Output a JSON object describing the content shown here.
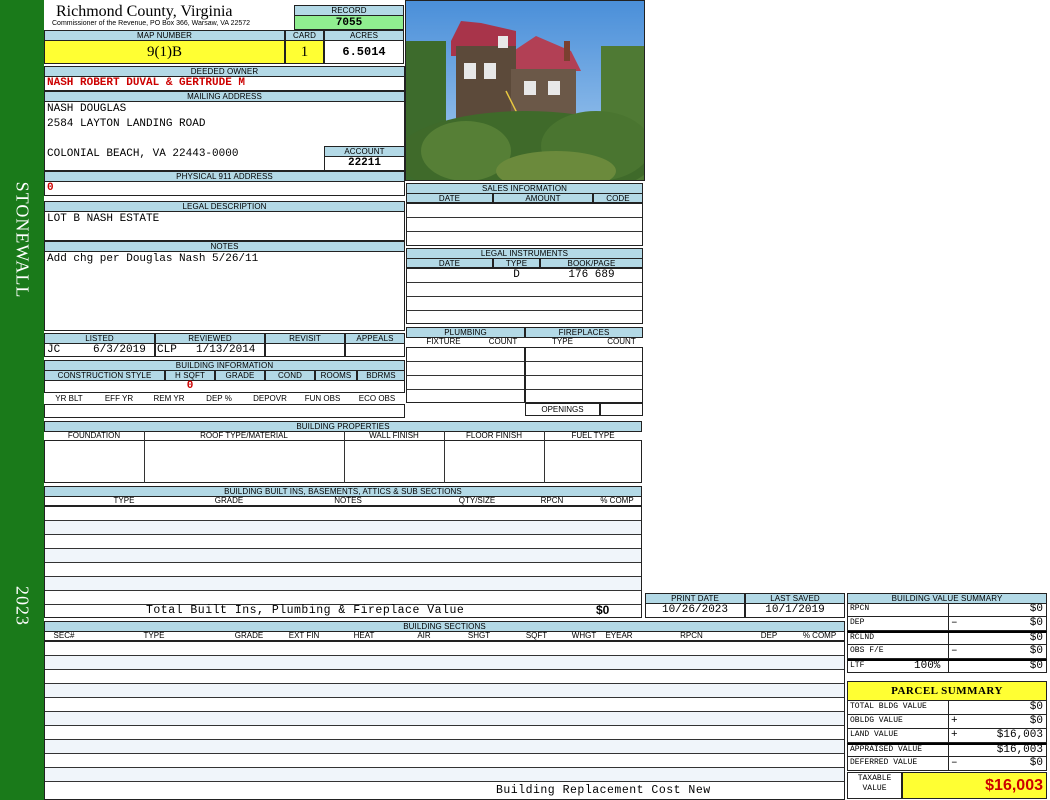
{
  "sidebar": {
    "district": "STONEWALL",
    "year": "2023"
  },
  "header": {
    "county": "Richmond County, Virginia",
    "address_line": "Commissioner of the Revenue, PO Box 366, Warsaw, VA 22572",
    "record_label": "RECORD",
    "record": "7055",
    "map_label": "MAP NUMBER",
    "map": "9(1)B",
    "card_label": "CARD",
    "card": "1",
    "acres_label": "ACRES",
    "acres": "6.5014"
  },
  "owner": {
    "label": "DEEDED OWNER",
    "name": "NASH ROBERT DUVAL & GERTRUDE M"
  },
  "mailing": {
    "label": "MAILING ADDRESS",
    "line1": "NASH DOUGLAS",
    "line2": "2584 LAYTON LANDING ROAD",
    "line3": "COLONIAL BEACH, VA 22443-0000"
  },
  "account": {
    "label": "ACCOUNT",
    "value": "22211"
  },
  "physical": {
    "label": "PHYSICAL 911 ADDRESS",
    "value": "0"
  },
  "legal": {
    "label": "LEGAL DESCRIPTION",
    "value": "LOT B NASH ESTATE"
  },
  "notes": {
    "label": "NOTES",
    "value": "Add chg per Douglas Nash 5/26/11"
  },
  "review": {
    "listed_label": "LISTED",
    "listed_by": "JC",
    "listed_date": "6/3/2019",
    "reviewed_label": "REVIEWED",
    "reviewed_by": "CLP",
    "reviewed_date": "1/13/2014",
    "revisit_label": "REVISIT",
    "appeals_label": "APPEALS"
  },
  "building_info": {
    "label": "BUILDING INFORMATION",
    "h1": [
      "CONSTRUCTION STYLE",
      "H SQFT",
      "GRADE",
      "COND",
      "ROOMS",
      "BDRMS"
    ],
    "hsqft": "0",
    "h2": [
      "YR BLT",
      "EFF YR",
      "REM YR",
      "DEP %",
      "DEPOVR",
      "FUN OBS",
      "ECO OBS"
    ]
  },
  "sales": {
    "label": "SALES INFORMATION",
    "cols": [
      "DATE",
      "AMOUNT",
      "CODE"
    ]
  },
  "instruments": {
    "label": "LEGAL INSTRUMENTS",
    "cols": [
      "DATE",
      "TYPE",
      "BOOK/PAGE"
    ],
    "type": "D",
    "bookpage": "176 689"
  },
  "plumbing": {
    "label": "PLUMBING",
    "cols": [
      "FIXTURE",
      "COUNT"
    ]
  },
  "fireplaces": {
    "label": "FIREPLACES",
    "cols": [
      "TYPE",
      "COUNT"
    ],
    "openings": "OPENINGS"
  },
  "properties": {
    "label": "BUILDING PROPERTIES",
    "cols": [
      "FOUNDATION",
      "ROOF TYPE/MATERIAL",
      "WALL FINISH",
      "FLOOR FINISH",
      "FUEL TYPE"
    ]
  },
  "builtins": {
    "label": "BUILDING BUILT INS, BASEMENTS, ATTICS & SUB SECTIONS",
    "cols": [
      "TYPE",
      "GRADE",
      "NOTES",
      "QTY/SIZE",
      "RPCN",
      "% COMP"
    ],
    "total_label": "Total Built Ins, Plumbing & Fireplace Value",
    "total": "$0"
  },
  "dates": {
    "print_label": "PRINT DATE",
    "print": "10/26/2023",
    "saved_label": "LAST SAVED",
    "saved": "10/1/2019"
  },
  "sections": {
    "label": "BUILDING SECTIONS",
    "cols": [
      "SEC#",
      "TYPE",
      "GRADE",
      "EXT FIN",
      "HEAT",
      "AIR",
      "SHGT",
      "SQFT",
      "WHGT",
      "EYEAR",
      "RPCN",
      "DEP",
      "% COMP"
    ],
    "footer": "Building Replacement Cost New"
  },
  "bvs": {
    "label": "BUILDING VALUE SUMMARY",
    "rows": [
      {
        "label": "RPCN",
        "op": "",
        "value": "$0"
      },
      {
        "label": "DEP",
        "op": "–",
        "value": "$0"
      },
      {
        "label": "RCLND",
        "op": "",
        "value": "$0"
      },
      {
        "label": "OBS F/E",
        "op": "–",
        "value": "$0"
      },
      {
        "label": "LTF",
        "pct": "100%",
        "op": "",
        "value": "$0"
      }
    ]
  },
  "parcel": {
    "label": "PARCEL SUMMARY",
    "rows": [
      {
        "label": "TOTAL BLDG VALUE",
        "op": "",
        "value": "$0"
      },
      {
        "label": "OBLDG VALUE",
        "op": "+",
        "value": "$0"
      },
      {
        "label": "LAND VALUE",
        "op": "+",
        "value": "$16,003"
      },
      {
        "label": "APPRAISED VALUE",
        "op": "",
        "value": "$16,003"
      },
      {
        "label": "DEFERRED VALUE",
        "op": "–",
        "value": "$0"
      }
    ],
    "taxable_label1": "TAXABLE",
    "taxable_label2": "VALUE",
    "taxable": "$16,003"
  },
  "colors": {
    "sidebar": "#1a7a1a",
    "header": "#b3d9e6",
    "highlight": "#ffff33",
    "record": "#90ee90",
    "owner": "#cc0000"
  }
}
